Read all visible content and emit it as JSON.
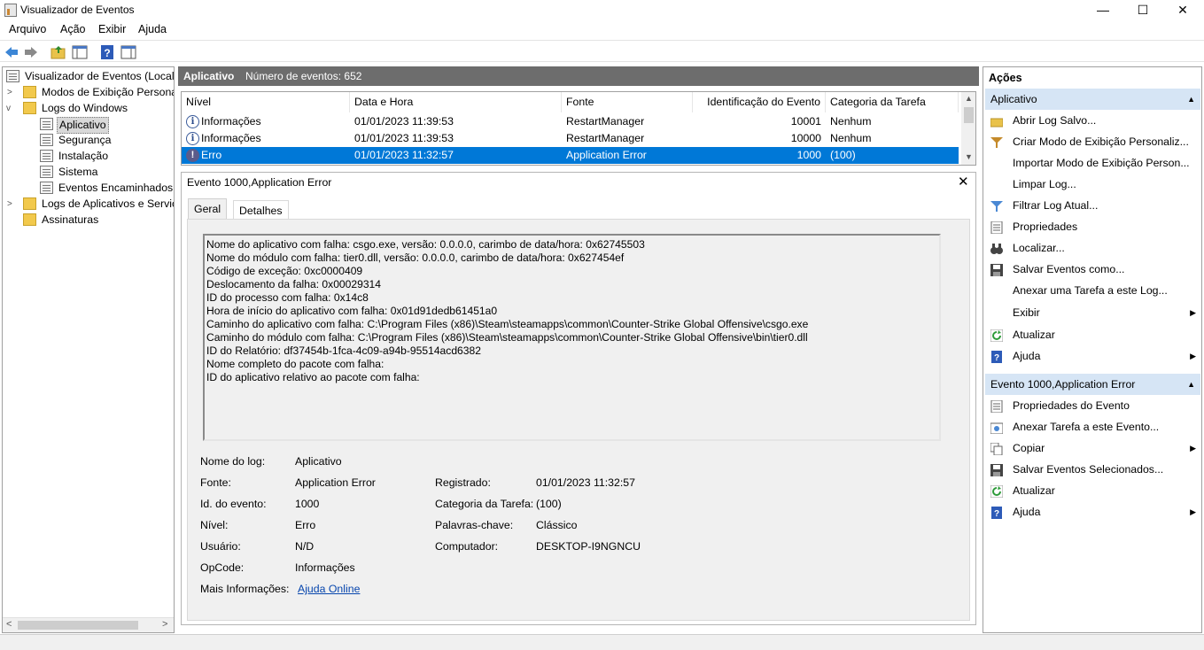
{
  "window": {
    "title": "Visualizador de Eventos",
    "minimize_glyph": "—",
    "maximize_glyph": "☐",
    "close_glyph": "✕"
  },
  "menu": [
    "Arquivo",
    "Ação",
    "Exibir",
    "Ajuda"
  ],
  "toolbar": {
    "icons": [
      "back-arrow-icon",
      "forward-arrow-icon",
      "up-folder-icon",
      "show-hide-tree-icon",
      "help-icon",
      "action-pane-icon"
    ]
  },
  "tree": {
    "root": "Visualizador de Eventos (Local)",
    "custom_views": "Modos de Exibição Personali",
    "windows_logs": "Logs do Windows",
    "logs": [
      "Aplicativo",
      "Segurança",
      "Instalação",
      "Sistema",
      "Eventos Encaminhados"
    ],
    "app_services": "Logs de Aplicativos e Serviço",
    "subscriptions": "Assinaturas"
  },
  "center": {
    "log_name": "Aplicativo",
    "event_count": "Número de eventos: 652"
  },
  "grid": {
    "columns": [
      "Nível",
      "Data e Hora",
      "Fonte",
      "Identificação do Evento",
      "Categoria da Tarefa"
    ],
    "rows": [
      {
        "level": "Informações",
        "date": "01/01/2023 11:39:53",
        "source": "RestartManager",
        "id": "10001",
        "category": "Nenhum"
      },
      {
        "level": "Informações",
        "date": "01/01/2023 11:39:53",
        "source": "RestartManager",
        "id": "10000",
        "category": "Nenhum"
      },
      {
        "level": "Erro",
        "date": "01/01/2023 11:32:57",
        "source": "Application Error",
        "id": "1000",
        "category": "(100)"
      }
    ]
  },
  "detail": {
    "title": "Evento 1000,Application Error",
    "tabs": [
      "Geral",
      "Detalhes"
    ],
    "description": [
      "Nome do aplicativo com falha: csgo.exe, versão: 0.0.0.0, carimbo de data/hora: 0x62745503",
      "Nome do módulo com falha: tier0.dll, versão: 0.0.0.0, carimbo de data/hora: 0x627454ef",
      "Código de exceção: 0xc0000409",
      "Deslocamento da falha: 0x00029314",
      "ID do processo com falha: 0x14c8",
      "Hora de início do aplicativo com falha: 0x01d91dedb61451a0",
      "Caminho do aplicativo com falha: C:\\Program Files (x86)\\Steam\\steamapps\\common\\Counter-Strike Global Offensive\\csgo.exe",
      "Caminho do módulo com falha: C:\\Program Files (x86)\\Steam\\steamapps\\common\\Counter-Strike Global Offensive\\bin\\tier0.dll",
      "ID do Relatório: df37454b-1fca-4c09-a94b-95514acd6382",
      "Nome completo do pacote com falha:",
      "ID do aplicativo relativo ao pacote com falha:"
    ],
    "fields": {
      "log_label": "Nome do log:",
      "log_value": "Aplicativo",
      "source_label": "Fonte:",
      "source_value": "Application Error",
      "logged_label": "Registrado:",
      "logged_value": "01/01/2023 11:32:57",
      "id_label": "Id. do evento:",
      "id_value": "1000",
      "category_label": "Categoria da Tarefa:",
      "category_value": "(100)",
      "level_label": "Nível:",
      "level_value": "Erro",
      "keywords_label": "Palavras-chave:",
      "keywords_value": "Clássico",
      "user_label": "Usuário:",
      "user_value": "N/D",
      "computer_label": "Computador:",
      "computer_value": "DESKTOP-I9NGNCU",
      "opcode_label": "OpCode:",
      "opcode_value": "Informações",
      "more_label": "Mais Informações:",
      "more_link": "Ajuda Online"
    }
  },
  "actions": {
    "title": "Ações",
    "section1": "Aplicativo",
    "items1": [
      {
        "label": "Abrir Log Salvo...",
        "icon": "open-folder-icon",
        "submenu": false
      },
      {
        "label": "Criar Modo de Exibição Personaliz...",
        "icon": "filter-create-icon",
        "submenu": false
      },
      {
        "label": "Importar Modo de Exibição Person...",
        "icon": "",
        "submenu": false
      },
      {
        "label": "Limpar Log...",
        "icon": "",
        "submenu": false
      },
      {
        "label": "Filtrar Log Atual...",
        "icon": "filter-icon",
        "submenu": false
      },
      {
        "label": "Propriedades",
        "icon": "properties-icon",
        "submenu": false
      },
      {
        "label": "Localizar...",
        "icon": "binoculars-icon",
        "submenu": false
      },
      {
        "label": "Salvar Eventos como...",
        "icon": "save-icon",
        "submenu": false
      },
      {
        "label": "Anexar uma Tarefa a este Log...",
        "icon": "",
        "submenu": false
      },
      {
        "label": "Exibir",
        "icon": "",
        "submenu": true
      },
      {
        "label": "Atualizar",
        "icon": "refresh-icon",
        "submenu": false
      },
      {
        "label": "Ajuda",
        "icon": "help-icon",
        "submenu": true
      }
    ],
    "section2": "Evento 1000,Application Error",
    "items2": [
      {
        "label": "Propriedades do Evento",
        "icon": "properties-icon",
        "submenu": false
      },
      {
        "label": "Anexar Tarefa a este Evento...",
        "icon": "task-icon",
        "submenu": false
      },
      {
        "label": "Copiar",
        "icon": "copy-icon",
        "submenu": true
      },
      {
        "label": "Salvar Eventos Selecionados...",
        "icon": "save-icon",
        "submenu": false
      },
      {
        "label": "Atualizar",
        "icon": "refresh-icon",
        "submenu": false
      },
      {
        "label": "Ajuda",
        "icon": "help-icon",
        "submenu": true
      }
    ]
  },
  "colors": {
    "selection": "#0078d7",
    "section_header": "#d6e5f5",
    "center_header": "#6d6d6d"
  }
}
